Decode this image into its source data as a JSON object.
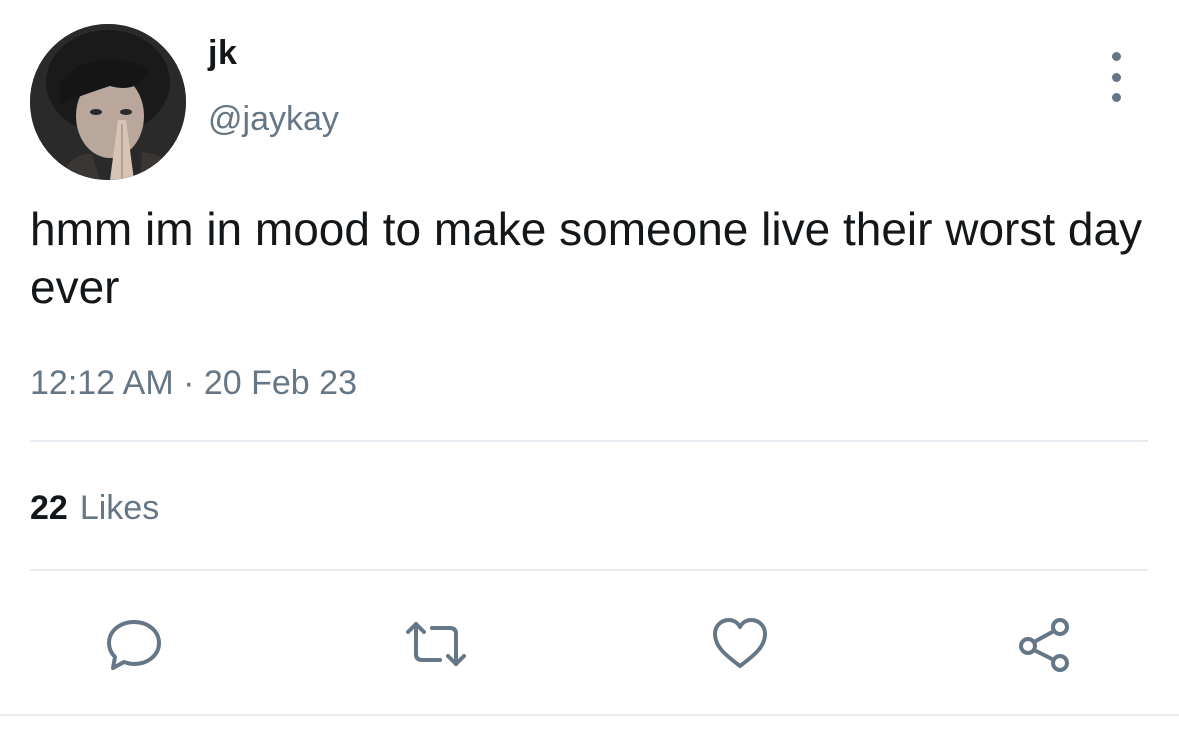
{
  "tweet": {
    "author": {
      "display_name": "jk",
      "handle": "@jaykay",
      "avatar_icon": "profile-photo"
    },
    "text": "hmm im in mood to make someone live their worst day ever",
    "timestamp": "12:12 AM · 20 Feb 23",
    "stats": {
      "likes_count": "22",
      "likes_label": "Likes"
    },
    "actions": [
      {
        "name": "reply",
        "icon": "speech-bubble-icon"
      },
      {
        "name": "retweet",
        "icon": "retweet-arrows-icon"
      },
      {
        "name": "like",
        "icon": "heart-icon"
      },
      {
        "name": "share",
        "icon": "share-nodes-icon"
      }
    ],
    "menu_icon": "vertical-ellipsis-icon"
  },
  "colors": {
    "primary_text": "#14171a",
    "secondary_text": "#657786",
    "divider": "#e6ecf0",
    "background": "#ffffff"
  }
}
